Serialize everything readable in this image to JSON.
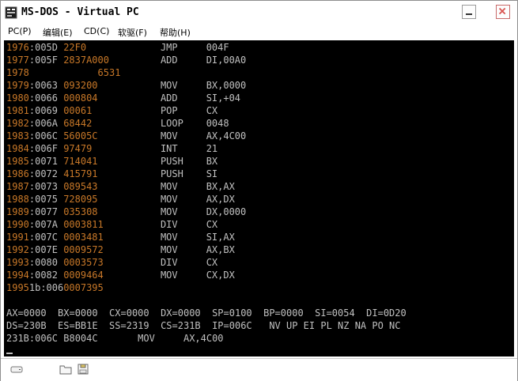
{
  "window": {
    "title": "MS-DOS - Virtual PC"
  },
  "menu": [
    {
      "label": "PC(P)"
    },
    {
      "label": "编辑(E)"
    },
    {
      "label": "CD(C)"
    },
    {
      "label": "软驱(F)"
    },
    {
      "label": "帮助(H)"
    }
  ],
  "listing": [
    {
      "ln": "1976",
      "addr": ":005D ",
      "hex": "22",
      "hex2": "F0",
      "mn": "JMP",
      "op": "004F"
    },
    {
      "ln": "1977",
      "addr": ":005F ",
      "hex": "2837",
      "hex2": "A000",
      "mn": "ADD",
      "op": "DI,00A0"
    },
    {
      "ln": "1978",
      "addr": "",
      "hex": "      6531",
      "hex2": "",
      "mn": "",
      "op": ""
    },
    {
      "ln": "1979",
      "addr": ":0063 ",
      "hex": "0932",
      "hex2": "00",
      "mn": "MOV",
      "op": "BX,0000"
    },
    {
      "ln": "1980",
      "addr": ":0066 ",
      "hex": "0008",
      "hex2": "04",
      "mn": "ADD",
      "op": "SI,+04"
    },
    {
      "ln": "1981",
      "addr": ":0069 ",
      "hex": "00061",
      "hex2": "",
      "mn": "POP",
      "op": "CX"
    },
    {
      "ln": "1982",
      "addr": ":006A ",
      "hex": "68442",
      "hex2": "",
      "mn": "LOOP",
      "op": "0048"
    },
    {
      "ln": "1983",
      "addr": ":006C ",
      "hex": "56005",
      "hex2": "C",
      "mn": "MOV",
      "op": "AX,4C00"
    },
    {
      "ln": "1984",
      "addr": ":006F ",
      "hex": "97479",
      "hex2": "",
      "mn": "INT",
      "op": "21"
    },
    {
      "ln": "1985",
      "addr": ":0071 ",
      "hex": "714041",
      "hex2": "",
      "mn": "PUSH",
      "op": "BX"
    },
    {
      "ln": "1986",
      "addr": ":0072 ",
      "hex": "415791",
      "hex2": "",
      "mn": "PUSH",
      "op": "SI"
    },
    {
      "ln": "1987",
      "addr": ":0073 ",
      "hex": "089543",
      "hex2": "",
      "mn": "MOV",
      "op": "BX,AX"
    },
    {
      "ln": "1988",
      "addr": ":0075 ",
      "hex": "728095",
      "hex2": "",
      "mn": "MOV",
      "op": "AX,DX"
    },
    {
      "ln": "1989",
      "addr": ":0077 ",
      "hex": "035308",
      "hex2": "",
      "mn": "MOV",
      "op": "DX,0000"
    },
    {
      "ln": "1990",
      "addr": ":007A ",
      "hex": "0003811",
      "hex2": "",
      "mn": "DIV",
      "op": "CX"
    },
    {
      "ln": "1991",
      "addr": ":007C ",
      "hex": "0003481",
      "hex2": "",
      "mn": "MOV",
      "op": "SI,AX"
    },
    {
      "ln": "1992",
      "addr": ":007E ",
      "hex": "0009572",
      "hex2": "",
      "mn": "MOV",
      "op": "AX,BX"
    },
    {
      "ln": "1993",
      "addr": ":0080 ",
      "hex": "0003573",
      "hex2": "",
      "mn": "DIV",
      "op": "CX"
    },
    {
      "ln": "1994",
      "addr": ":0082 ",
      "hex": "0009464",
      "hex2": "",
      "mn": "MOV",
      "op": "CX,DX"
    },
    {
      "ln": "1995",
      "addr": "1b:006",
      "hex": "0007395",
      "hex2": "",
      "mn": "",
      "op": ""
    }
  ],
  "registers": {
    "line1": "AX=0000  BX=0000  CX=0000  DX=0000  SP=0100  BP=0000  SI=0054  DI=0D20",
    "line2": "DS=230B  ES=BB1E  SS=2319  CS=231B  IP=006C   NV UP EI PL NZ NA PO NC",
    "line3": "231B:006C B8004C       MOV     AX,4C00"
  },
  "icons": {
    "app": "ms-dos-icon",
    "minimize": "minimize-icon",
    "close": "close-icon",
    "status": [
      "drive-icon",
      "folder-icon",
      "floppy-icon"
    ]
  },
  "colors": {
    "screen_bg": "#000000",
    "line_number": "#c87828",
    "text": "#c0c0c0",
    "close": "#d9534f"
  }
}
